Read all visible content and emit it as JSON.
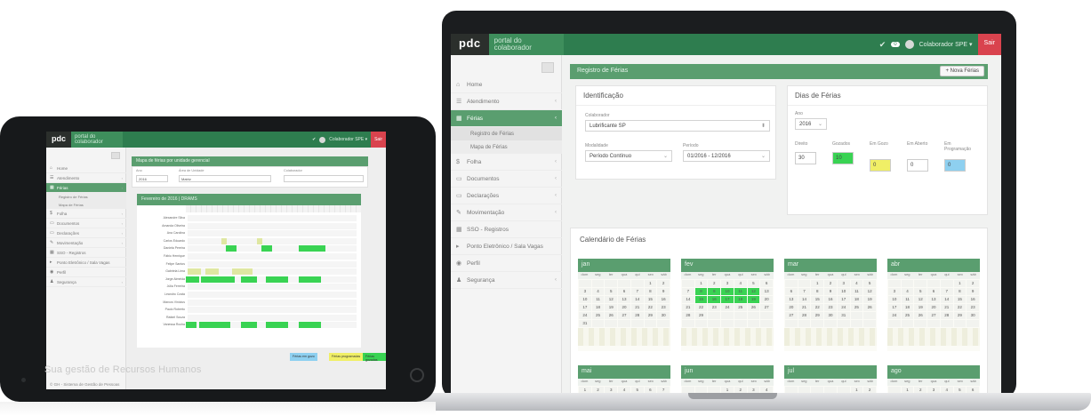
{
  "laptop": {
    "logo": "pdc",
    "brand_line1": "portal do",
    "brand_line2": "colaborador",
    "bell": "✔",
    "badge": "0",
    "user": "Colaborador SPE ▾",
    "exit": "Sair",
    "sidebar": [
      {
        "icon": "⌂",
        "label": "Home",
        "caret": ""
      },
      {
        "icon": "☰",
        "label": "Atendimento",
        "caret": "‹"
      },
      {
        "icon": "▦",
        "label": "Férias",
        "caret": "‹",
        "active": true
      },
      {
        "icon": "$",
        "label": "Folha",
        "caret": "‹"
      },
      {
        "icon": "▭",
        "label": "Documentos",
        "caret": "‹"
      },
      {
        "icon": "▭",
        "label": "Declarações",
        "caret": "‹"
      },
      {
        "icon": "✎",
        "label": "Movimentação",
        "caret": "‹"
      },
      {
        "icon": "▦",
        "label": "SSO - Registros",
        "caret": ""
      },
      {
        "icon": "▸",
        "label": "Ponto Eletrônico / Sala Vagas",
        "caret": ""
      },
      {
        "icon": "◉",
        "label": "Perfil",
        "caret": ""
      },
      {
        "icon": "♟",
        "label": "Segurança",
        "caret": "‹"
      }
    ],
    "sidebar_sub": [
      "Registro de Férias",
      "Mapa de Férias"
    ],
    "panel_title": "Registro de Férias",
    "add_button": "Nova Férias",
    "ident": {
      "title": "Identificação",
      "collab_label": "Colaborador",
      "collab_value": "Lubrificante SP",
      "modal_label": "Modalidade",
      "modal_value": "Período Contínuo",
      "period_label": "Período",
      "period_value": "01/2016 - 12/2016"
    },
    "days": {
      "title": "Dias de Férias",
      "year_label": "Ano",
      "year_value": "2016",
      "cols": [
        {
          "label": "Direito",
          "value": "30",
          "cls": ""
        },
        {
          "label": "Gozados",
          "value": "10",
          "cls": "green"
        },
        {
          "label": "Em Gozo",
          "value": "0",
          "cls": "yellow"
        },
        {
          "label": "Em Aberto",
          "value": "0",
          "cls": ""
        },
        {
          "label": "Em Programação",
          "value": "0",
          "cls": "blue"
        }
      ]
    },
    "calendar": {
      "title": "Calendário de Férias",
      "weekdays": [
        "dom",
        "seg",
        "ter",
        "qua",
        "qui",
        "sex",
        "sáb"
      ],
      "months": [
        "jan",
        "fev",
        "mar",
        "abr",
        "mai",
        "jun",
        "jul",
        "ago"
      ]
    }
  },
  "tablet": {
    "logo": "pdc",
    "brand_line1": "portal do",
    "brand_line2": "colaborador",
    "user": "Colaborador SPE ▾",
    "exit": "Sair",
    "sidebar": [
      {
        "icon": "⌂",
        "label": "Home",
        "caret": ""
      },
      {
        "icon": "☰",
        "label": "Atendimento",
        "caret": "‹"
      },
      {
        "icon": "▦",
        "label": "Férias",
        "caret": "‹",
        "active": true
      },
      {
        "icon": "$",
        "label": "Folha",
        "caret": "‹"
      },
      {
        "icon": "▭",
        "label": "Documentos",
        "caret": "‹"
      },
      {
        "icon": "▭",
        "label": "Declarações",
        "caret": "‹"
      },
      {
        "icon": "✎",
        "label": "Movimentação",
        "caret": "‹"
      },
      {
        "icon": "▦",
        "label": "SSO - Registros",
        "caret": ""
      },
      {
        "icon": "▸",
        "label": "Ponto Eletrônico / Sala Vagas",
        "caret": ""
      },
      {
        "icon": "◉",
        "label": "Perfil",
        "caret": ""
      },
      {
        "icon": "♟",
        "label": "Segurança",
        "caret": "‹"
      }
    ],
    "sidebar_sub": [
      "Registro de Férias",
      "Mapa de Férias"
    ],
    "footer": "© GH - Sistema de Gestão de Pessoas",
    "panel_title": "Mapa de férias por unidade gerencial",
    "filter": {
      "year_label": "Ano",
      "year_value": "2016",
      "unit_label": "Área de Unidade",
      "unit_value": "Matriz",
      "collab_label": "Colaborador"
    },
    "grid_title": "Fevereiro de 2016 | DRAMS",
    "rows": [
      "Alexandre Silva",
      "Amanda Oliveira",
      "Ana Carolina",
      "Carlos Eduardo",
      "Daniela Pereira",
      "Fábio Henrique",
      "Felipe Santos",
      "Gabriela Lima",
      "Jorge Almeida",
      "Júlia Ferreira",
      "Leandro Costa",
      "Marcos Vinícius",
      "Paulo Roberto",
      "Rafael Souza",
      "Vanessa Rocha"
    ],
    "legend": [
      "Férias em gozo",
      "Férias programadas",
      "Férias gozadas"
    ]
  },
  "hero_text": "Sua gestão de Recursos Humanos"
}
